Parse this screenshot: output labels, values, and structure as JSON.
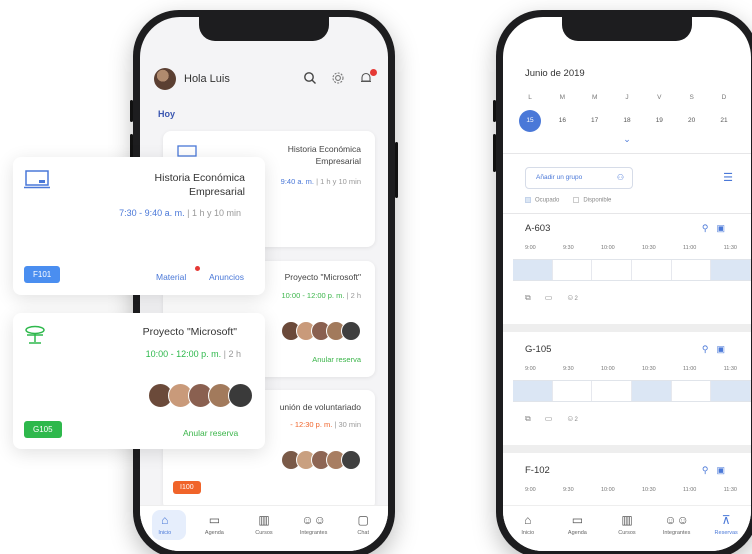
{
  "left_phone": {
    "greeting": "Hola Luis",
    "section": "Hoy",
    "cards": [
      {
        "title_line1": "Historia Económica",
        "title_line2": "Empresarial",
        "time": "9:40 a. m.",
        "duration": "| 1 h y 10 min"
      },
      {
        "title": "Proyecto \"Microsoft\"",
        "time": "10:00 - 12:00 p. m.",
        "duration": "| 2 h",
        "action": "Anular reserva"
      },
      {
        "title": "unión de voluntariado",
        "time": "- 12:30 p. m.",
        "duration": "| 30 min",
        "badge": "I100"
      }
    ],
    "nav": [
      {
        "label": "Inicio",
        "icon": "home-icon"
      },
      {
        "label": "Agenda",
        "icon": "calendar-icon"
      },
      {
        "label": "Cursos",
        "icon": "books-icon"
      },
      {
        "label": "Integrantes",
        "icon": "people-icon"
      },
      {
        "label": "Chat",
        "icon": "chat-icon"
      }
    ]
  },
  "float_cards": [
    {
      "title_line1": "Historia Económica",
      "title_line2": "Empresarial",
      "time": "7:30 - 9:40 a. m.",
      "duration": " | 1 h y 10 min",
      "badge": "F101",
      "link1": "Material",
      "link2": "Anuncios"
    },
    {
      "title": "Proyecto \"Microsoft\"",
      "time": "10:00 - 12:00 p. m.",
      "duration": " | 2 h",
      "badge": "G105",
      "action": "Anular reserva"
    }
  ],
  "right_phone": {
    "month": "Junio de 2019",
    "weekdays": [
      "L",
      "M",
      "M",
      "J",
      "V",
      "S",
      "D"
    ],
    "days": [
      "15",
      "16",
      "17",
      "18",
      "19",
      "20",
      "21"
    ],
    "selected_day": "15",
    "add_group": "Añadir un grupo",
    "legend_busy": "Ocupado",
    "legend_free": "Disponible",
    "times": [
      "9:00",
      "9:30",
      "10:00",
      "10:30",
      "11:00",
      "11:30"
    ],
    "rooms": [
      {
        "name": "A-603",
        "people": "2"
      },
      {
        "name": "G-105",
        "people": "2"
      },
      {
        "name": "F-102",
        "people": ""
      }
    ],
    "nav": [
      {
        "label": "Inicio"
      },
      {
        "label": "Agenda"
      },
      {
        "label": "Cursos"
      },
      {
        "label": "Integrantes"
      },
      {
        "label": "Reservas"
      }
    ]
  },
  "colors": {
    "accent_blue": "#4a78d8",
    "green": "#3bb54a",
    "badge_blue": "#4a8ef0",
    "badge_green": "#2eb84c",
    "badge_orange": "#f0642a",
    "busy_slot": "#dbe6f4"
  }
}
